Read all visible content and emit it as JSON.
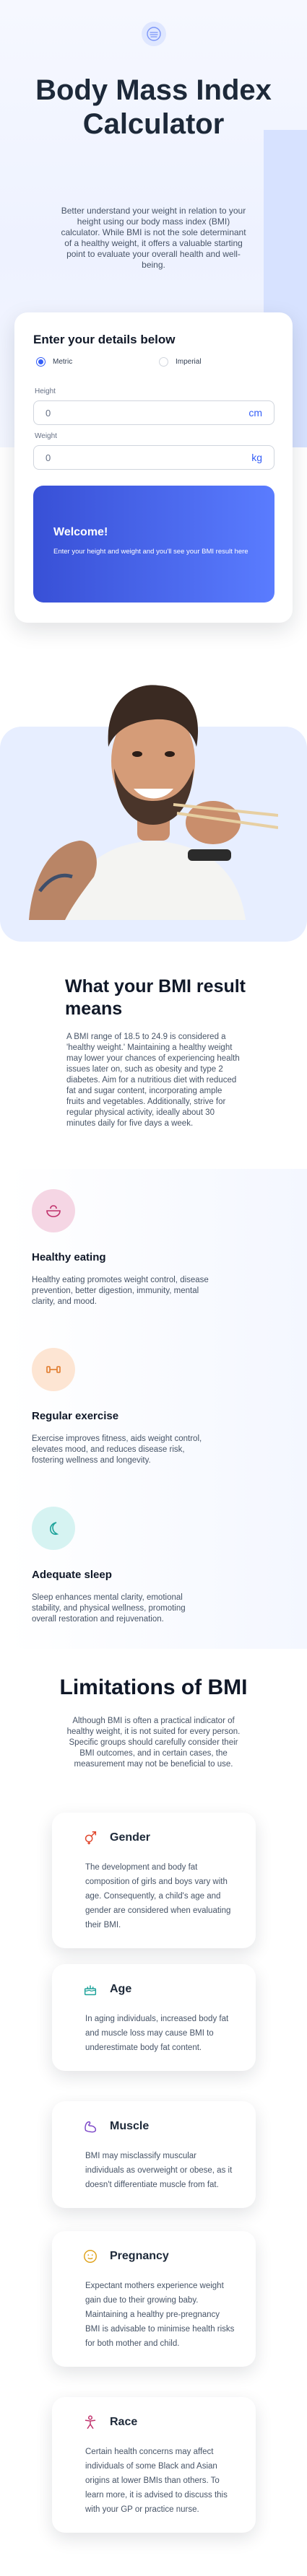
{
  "hero": {
    "title": "Body Mass Index Calculator",
    "description": "Better understand your weight in relation to your height using our body mass index (BMI) calculator. While BMI is not the sole determinant of a healthy weight, it offers a valuable starting point to evaluate your overall health and well-being."
  },
  "form": {
    "heading": "Enter your details below",
    "unit_metric": "Metric",
    "unit_imperial": "Imperial",
    "selected_unit": "Metric",
    "height_label": "Height",
    "height_placeholder": "0",
    "height_unit": "cm",
    "weight_label": "Weight",
    "weight_placeholder": "0",
    "weight_unit": "kg",
    "result_title": "Welcome!",
    "result_text": "Enter your height and weight and you'll see your BMI result here"
  },
  "meaning": {
    "title": "What your BMI result means",
    "text": "A BMI range of 18.5 to 24.9 is considered a 'healthy weight.' Maintaining a healthy weight may lower your chances of experiencing health issues later on, such as obesity and type 2 diabetes. Aim for a nutritious diet with reduced fat and sugar content, incorporating ample fruits and vegetables. Additionally, strive for regular physical activity, ideally about 30 minutes daily for five days a week."
  },
  "tips": [
    {
      "icon": "bowl-icon",
      "title": "Healthy eating",
      "text": "Healthy eating promotes weight control, disease prevention, better digestion, immunity, mental clarity, and mood.",
      "color": "#f5d6e4"
    },
    {
      "icon": "dumbbell-icon",
      "title": "Regular exercise",
      "text": "Exercise improves fitness, aids weight control, elevates mood, and reduces disease risk, fostering wellness and longevity.",
      "color": "#fde5d3"
    },
    {
      "icon": "moon-icon",
      "title": "Adequate sleep",
      "text": "Sleep enhances mental clarity, emotional stability, and physical wellness, promoting overall restoration and rejuvenation.",
      "color": "#d6f3f2"
    }
  ],
  "limitations": {
    "title": "Limitations of BMI",
    "text": "Although BMI is often a practical indicator of healthy weight, it is not suited for every person. Specific groups should carefully consider their BMI outcomes, and in certain cases, the measurement may not be beneficial to use.",
    "items": [
      {
        "icon": "gender-icon",
        "title": "Gender",
        "text": "The development and body fat composition of girls and boys vary with age. Consequently, a child's age and gender are considered when evaluating their BMI."
      },
      {
        "icon": "cake-icon",
        "title": "Age",
        "text": "In aging individuals, increased body fat and muscle loss may cause BMI to underestimate body fat content."
      },
      {
        "icon": "muscle-icon",
        "title": "Muscle",
        "text": "BMI may misclassify muscular individuals as overweight or obese, as it doesn't differentiate muscle from fat."
      },
      {
        "icon": "pregnancy-icon",
        "title": "Pregnancy",
        "text": "Expectant mothers experience weight gain due to their growing baby. Maintaining a healthy pre-pregnancy BMI is advisable to minimise health risks for both mother and child."
      },
      {
        "icon": "race-icon",
        "title": "Race",
        "text": "Certain health concerns may affect individuals of some Black and Asian origins at lower BMIs than others. To learn more, it is advised to discuss this with your GP or practice nurse."
      }
    ]
  },
  "colors": {
    "accent": "#345ef7",
    "heading": "#101828",
    "body": "#475467"
  }
}
